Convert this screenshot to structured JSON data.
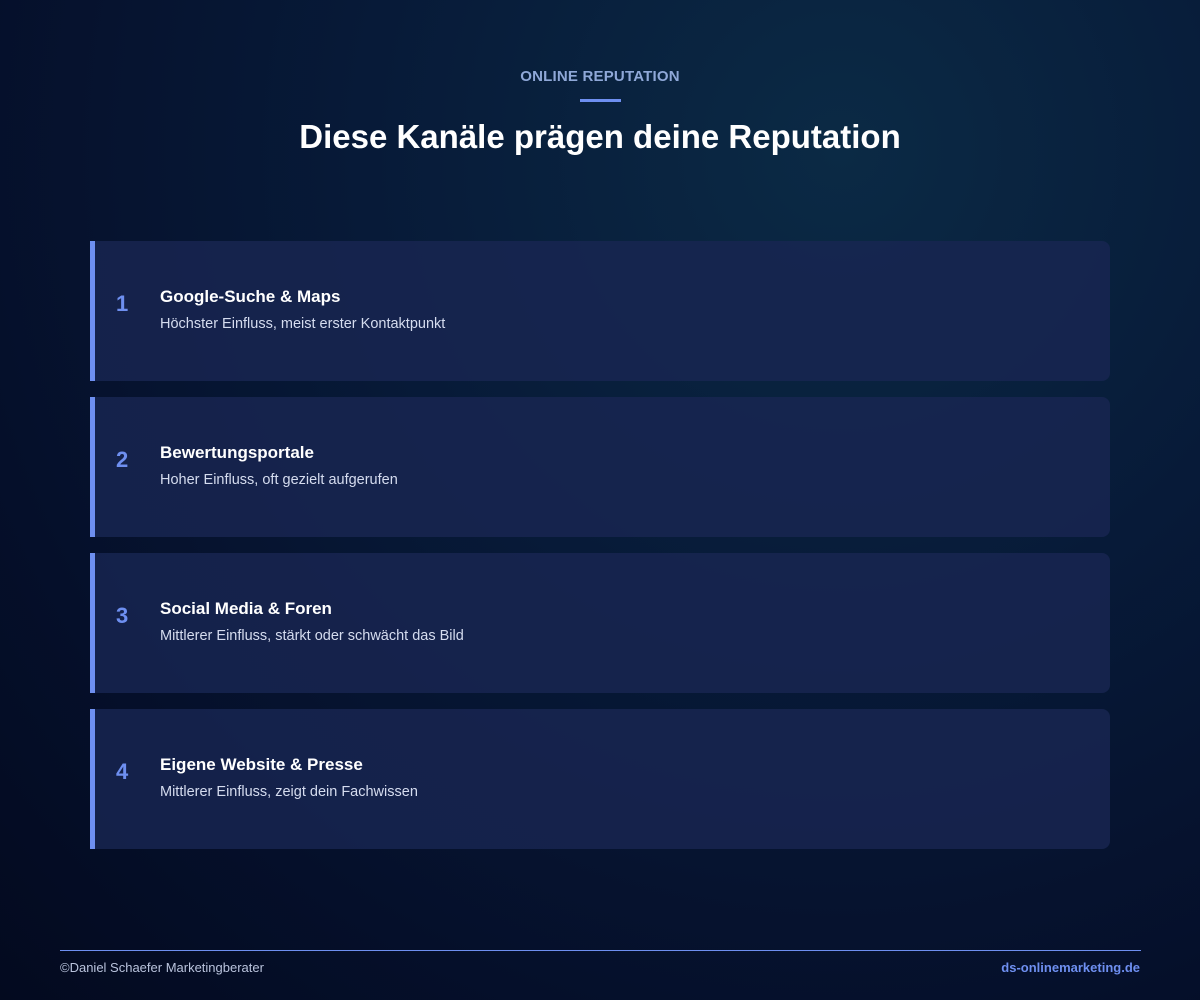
{
  "header": {
    "eyebrow": "ONLINE REPUTATION",
    "title": "Diese Kanäle prägen deine Reputation"
  },
  "channels": [
    {
      "number": "1",
      "title": "Google-Suche & Maps",
      "description": "Höchster Einfluss, meist erster Kontaktpunkt"
    },
    {
      "number": "2",
      "title": "Bewertungsportale",
      "description": "Hoher Einfluss, oft gezielt aufgerufen"
    },
    {
      "number": "3",
      "title": "Social Media & Foren",
      "description": "Mittlerer Einfluss, stärkt oder schwächt das Bild"
    },
    {
      "number": "4",
      "title": "Eigene Website & Presse",
      "description": "Mittlerer Einfluss, zeigt dein Fachwissen"
    }
  ],
  "footer": {
    "copyright": "©Daniel Schaefer Marketingberater",
    "website": "ds-onlinemarketing.de"
  },
  "colors": {
    "accent": "#6e8ff0",
    "card_background": "#182652",
    "page_background": "#050f2a"
  }
}
